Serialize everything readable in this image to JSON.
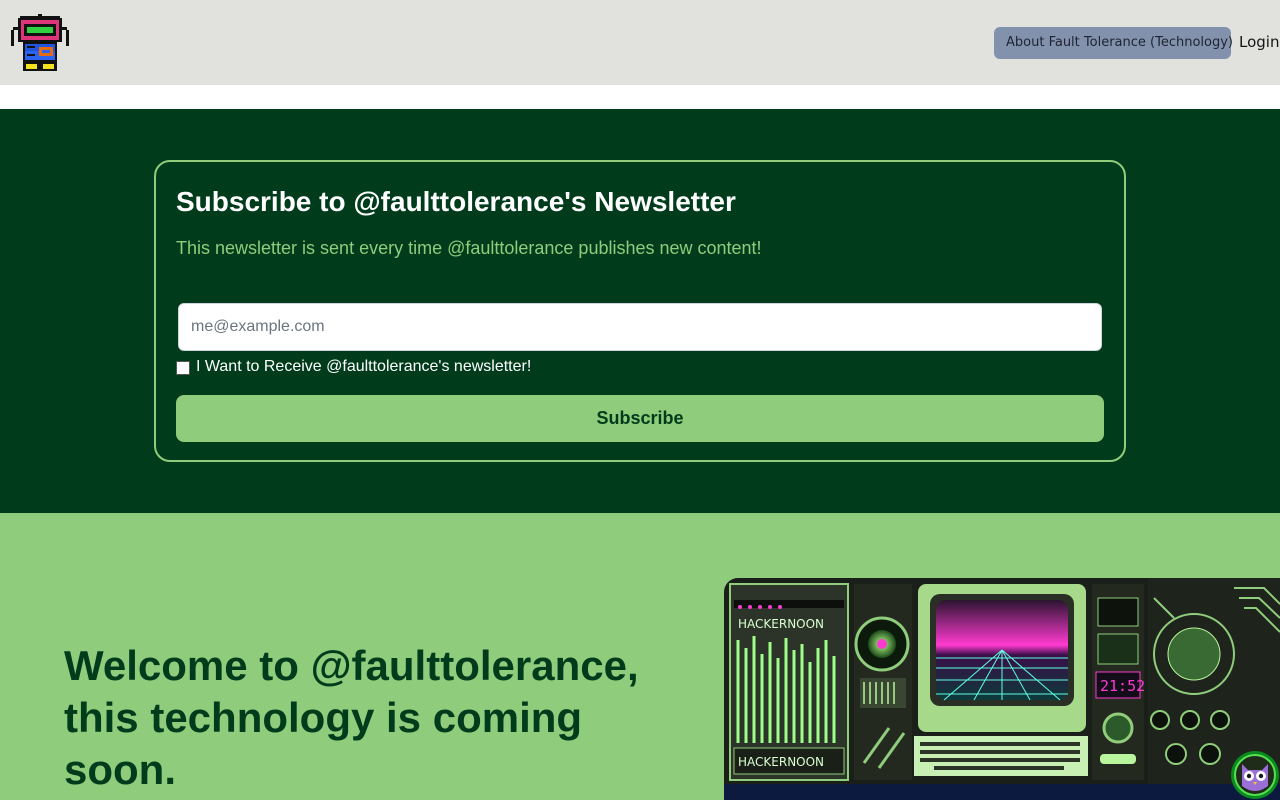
{
  "header": {
    "about_label": "About Fault Tolerance (Technology)",
    "login_label": "Login"
  },
  "newsletter": {
    "title": "Subscribe to @faulttolerance's Newsletter",
    "subtitle": "This newsletter is sent every time @faulttolerance publishes new content!",
    "email_placeholder": "me@example.com",
    "checkbox_label": "I Want to Receive @faulttolerance's newsletter!",
    "checkbox_checked": false,
    "subscribe_label": "Subscribe"
  },
  "welcome": {
    "title": "Welcome to @faulttolerance, this technology is coming soon."
  },
  "hero": {
    "brand_top": "HACKERNOON",
    "brand_bottom": "HACKERNOON",
    "clock": "21:52"
  },
  "colors": {
    "dark_green": "#003c1c",
    "light_green": "#8fcc7b",
    "header_bg": "#e1e2de",
    "about_button": "#8292ad"
  },
  "icons": {
    "logo": "robot-logo-icon",
    "avatar": "owl-avatar-icon"
  }
}
